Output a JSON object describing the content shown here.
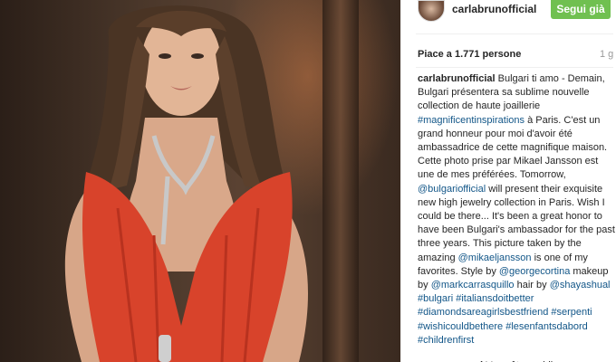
{
  "post": {
    "username": "carlabrunofficial",
    "follow_label": "Segui già",
    "likes": "Piace a 1.771 persone",
    "time": "1 g",
    "image_alt": "Photo"
  },
  "colors": {
    "follow_bg": "#70c050",
    "link": "#125688",
    "dress": "#d8432b"
  },
  "comments": [
    {
      "author": "carlabrunofficial",
      "segments": [
        {
          "t": "Bulgari ti amo - Demain, Bulgari présentera sa sublime nouvelle collection de haute joaillerie "
        },
        {
          "t": "#magnificentinspirations",
          "link": true
        },
        {
          "t": " à Paris. C'est un grand honneur pour moi d'avoir été ambassadrice de cette magnifique maison. Cette photo prise par Mikael Jansson est une de mes préférées. Tomorrow, "
        },
        {
          "t": "@bulgariofficial",
          "link": true
        },
        {
          "t": " will present their exquisite new high jewelry collection in Paris. Wish I could be there... It's been a great honor to have been Bulgari's ambassador for the past three years. This picture taken by the amazing "
        },
        {
          "t": "@mikaeljansson",
          "link": true
        },
        {
          "t": " is one of my favorites. Style by "
        },
        {
          "t": "@georgecortina",
          "link": true
        },
        {
          "t": " makeup by "
        },
        {
          "t": "@markcarrasquillo",
          "link": true
        },
        {
          "t": " hair by "
        },
        {
          "t": "@shayashual",
          "link": true
        },
        {
          "t": " "
        },
        {
          "t": "#bulgari",
          "link": true
        },
        {
          "t": " "
        },
        {
          "t": "#italiansdoitbetter",
          "link": true
        },
        {
          "t": " "
        },
        {
          "t": "#diamondsareagirlsbestfriend",
          "link": true
        },
        {
          "t": " "
        },
        {
          "t": "#serpenti",
          "link": true
        },
        {
          "t": " "
        },
        {
          "t": "#wishicouldbethere",
          "link": true
        },
        {
          "t": " "
        },
        {
          "t": "#lesenfantsdabord",
          "link": true
        },
        {
          "t": " "
        },
        {
          "t": "#childrenfirst",
          "link": true
        }
      ]
    },
    {
      "author": "sunnyarmand",
      "segments": [
        {
          "t": "Vous êtes sublime"
        }
      ]
    }
  ]
}
